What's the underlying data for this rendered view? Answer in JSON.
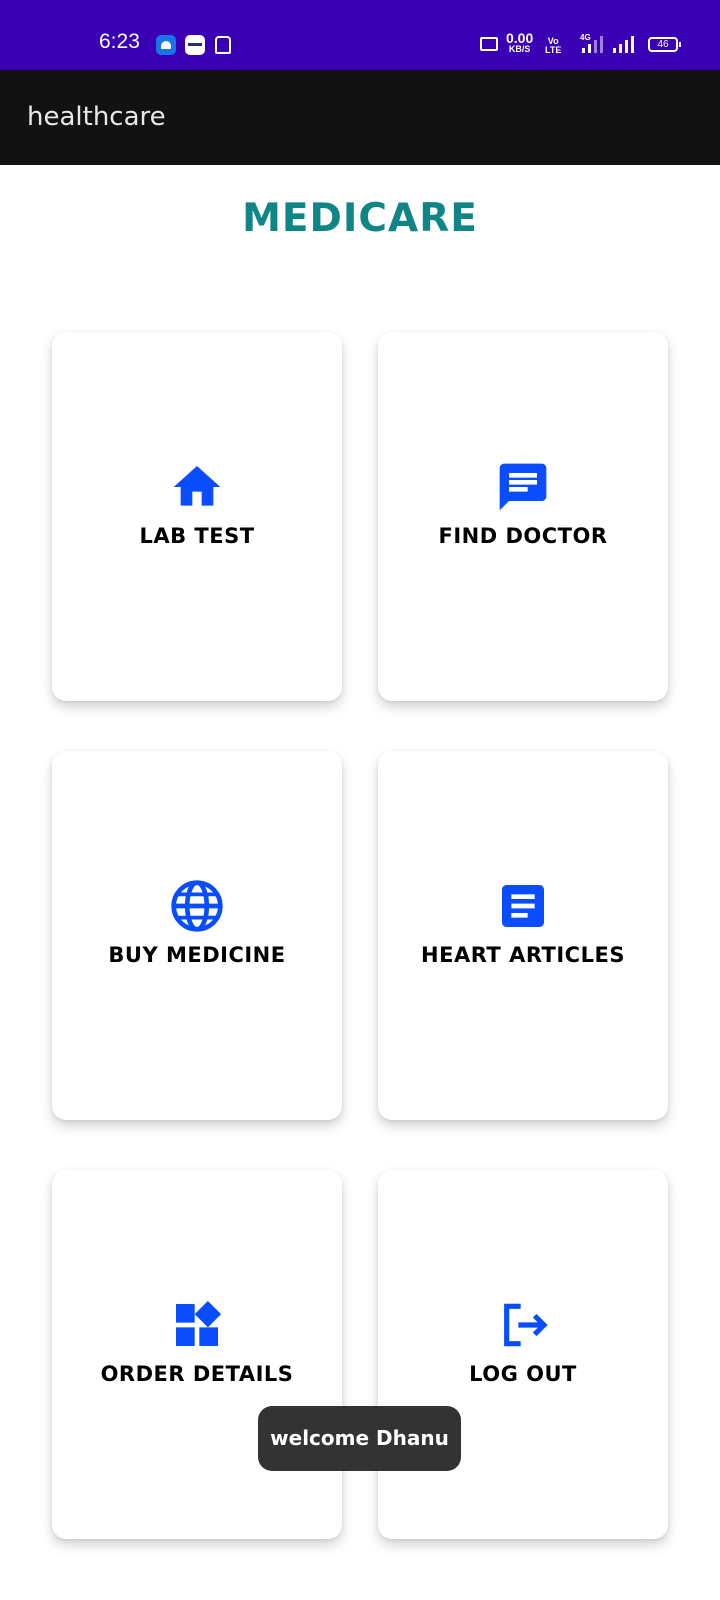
{
  "status_bar": {
    "time": "6:23",
    "net_speed_value": "0.00",
    "net_speed_unit": "KB/S",
    "volte_line1": "Vo",
    "volte_line2": "LTE",
    "network_type": "4G",
    "battery": "46",
    "background_color": "#3a00b4"
  },
  "app_bar": {
    "title": "healthcare",
    "background_color": "#121212"
  },
  "page": {
    "heading": "MEDICARE",
    "heading_color": "#0f8585",
    "icon_color": "#0a4dff"
  },
  "cards": [
    {
      "label": "LAB TEST",
      "icon": "home-icon"
    },
    {
      "label": "FIND DOCTOR",
      "icon": "message-icon"
    },
    {
      "label": "BUY MEDICINE",
      "icon": "globe-icon"
    },
    {
      "label": "HEART ARTICLES",
      "icon": "article-icon"
    },
    {
      "label": "ORDER DETAILS",
      "icon": "widgets-icon"
    },
    {
      "label": "LOG OUT",
      "icon": "logout-icon"
    }
  ],
  "toast": {
    "message": "welcome Dhanu"
  }
}
